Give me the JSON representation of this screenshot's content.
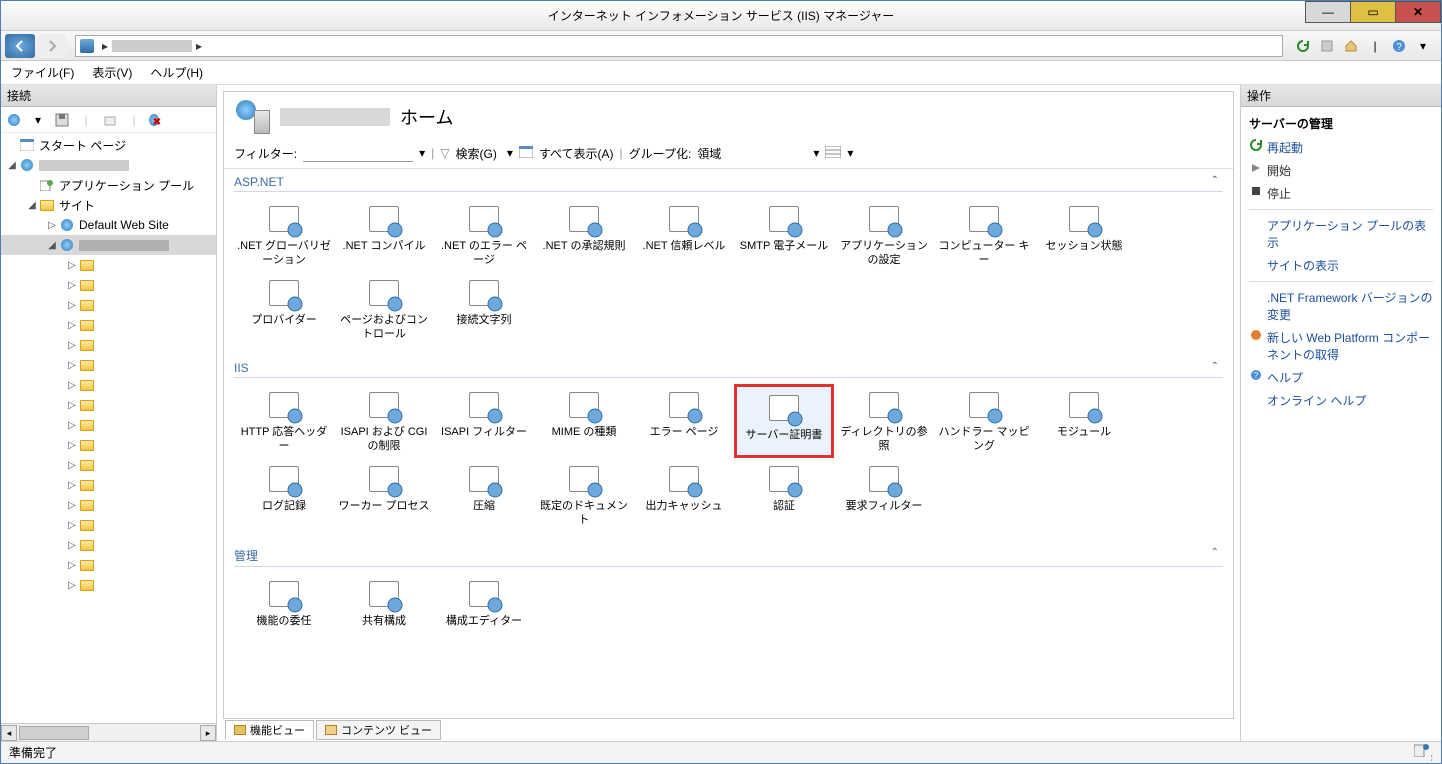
{
  "window": {
    "title": "インターネット インフォメーション サービス (IIS) マネージャー"
  },
  "menu": {
    "file": "ファイル(F)",
    "view": "表示(V)",
    "help": "ヘルプ(H)"
  },
  "left": {
    "header": "接続",
    "start_page": "スタート ページ",
    "app_pools": "アプリケーション プール",
    "sites": "サイト",
    "default_site": "Default Web Site"
  },
  "main": {
    "home_suffix": "ホーム",
    "filter_label": "フィルター:",
    "search_label": "検索(G)",
    "show_all": "すべて表示(A)",
    "group_by_label": "グループ化:",
    "group_by_value": "領域",
    "groups": {
      "aspnet": "ASP.NET",
      "iis": "IIS",
      "mgmt": "管理"
    },
    "aspnet_items": [
      ".NET グローバリゼーション",
      ".NET コンパイル",
      ".NET のエラー ページ",
      ".NET の承認規則",
      ".NET 信頼レベル",
      "SMTP 電子メール",
      "アプリケーションの設定",
      "コンピューター キー",
      "セッション状態",
      "プロバイダー",
      "ページおよびコントロール",
      "接続文字列"
    ],
    "iis_items": [
      "HTTP 応答ヘッダー",
      "ISAPI および CGI の制限",
      "ISAPI フィルター",
      "MIME の種類",
      "エラー ページ",
      "サーバー証明書",
      "ディレクトリの参照",
      "ハンドラー マッピング",
      "モジュール",
      "ログ記録",
      "ワーカー プロセス",
      "圧縮",
      "既定のドキュメント",
      "出力キャッシュ",
      "認証",
      "要求フィルター"
    ],
    "mgmt_items": [
      "機能の委任",
      "共有構成",
      "構成エディター"
    ],
    "highlight_index": 5,
    "tabs": {
      "features": "機能ビュー",
      "content": "コンテンツ ビュー"
    }
  },
  "actions": {
    "header": "操作",
    "group1": "サーバーの管理",
    "restart": "再起動",
    "start": "開始",
    "stop": "停止",
    "app_pools": "アプリケーション プールの表示",
    "sites": "サイトの表示",
    "netfx": ".NET Framework バージョンの変更",
    "webpi": "新しい Web Platform コンポーネントの取得",
    "help": "ヘルプ",
    "online_help": "オンライン ヘルプ"
  },
  "status": {
    "text": "準備完了"
  }
}
